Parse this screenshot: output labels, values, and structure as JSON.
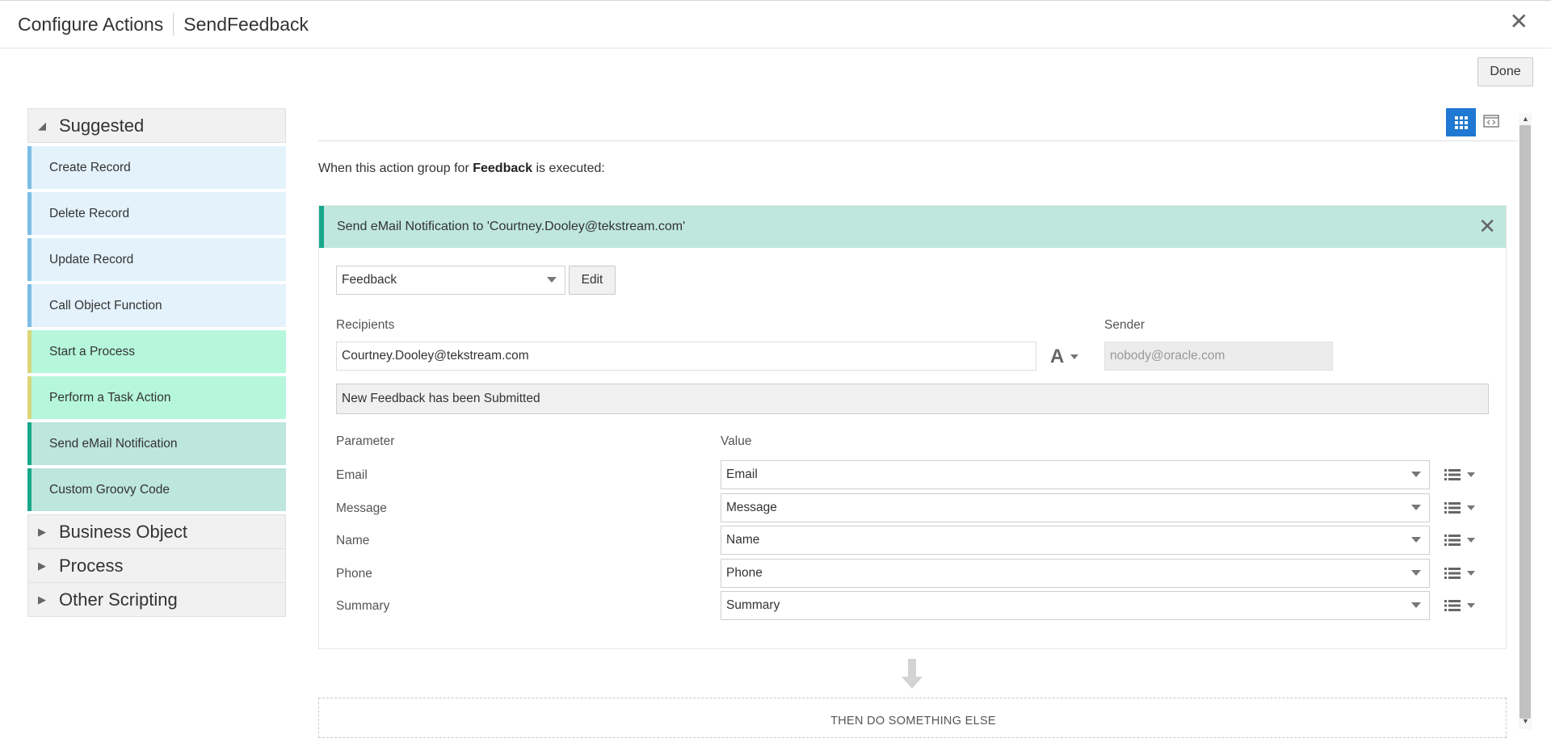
{
  "header": {
    "title": "Configure Actions",
    "subtitle": "SendFeedback"
  },
  "done_label": "Done",
  "left_panel": {
    "suggested_label": "Suggested",
    "items": [
      {
        "label": "Create Record",
        "style": "blue"
      },
      {
        "label": "Delete Record",
        "style": "blue"
      },
      {
        "label": "Update Record",
        "style": "blue"
      },
      {
        "label": "Call Object Function",
        "style": "blue"
      },
      {
        "label": "Start a Process",
        "style": "mint"
      },
      {
        "label": "Perform a Task Action",
        "style": "mint"
      },
      {
        "label": "Send eMail Notification",
        "style": "teal"
      },
      {
        "label": "Custom Groovy Code",
        "style": "teal"
      }
    ],
    "groups": [
      "Business Object",
      "Process",
      "Other Scripting"
    ]
  },
  "when": {
    "prefix": "When this action group for",
    "object": "Feedback",
    "suffix": "is executed:"
  },
  "action": {
    "title": "Send eMail Notification to 'Courtney.Dooley@tekstream.com'",
    "template_value": "Feedback",
    "edit_label": "Edit",
    "recipients_label": "Recipients",
    "recipients_value": "Courtney.Dooley@tekstream.com",
    "sender_label": "Sender",
    "sender_placeholder": "nobody@oracle.com",
    "subject_value": "New Feedback has been Submitted",
    "parameter_header": "Parameter",
    "value_header": "Value",
    "params": [
      {
        "name": "Email",
        "value": "Email"
      },
      {
        "name": "Message",
        "value": "Message"
      },
      {
        "name": "Name",
        "value": "Name"
      },
      {
        "name": "Phone",
        "value": "Phone"
      },
      {
        "name": "Summary",
        "value": "Summary"
      }
    ]
  },
  "then_label": "THEN DO SOMETHING ELSE",
  "colors": {
    "accent": "#1f78d1",
    "email_header": "#bfe7dd",
    "teal_bar": "#19a88b"
  }
}
